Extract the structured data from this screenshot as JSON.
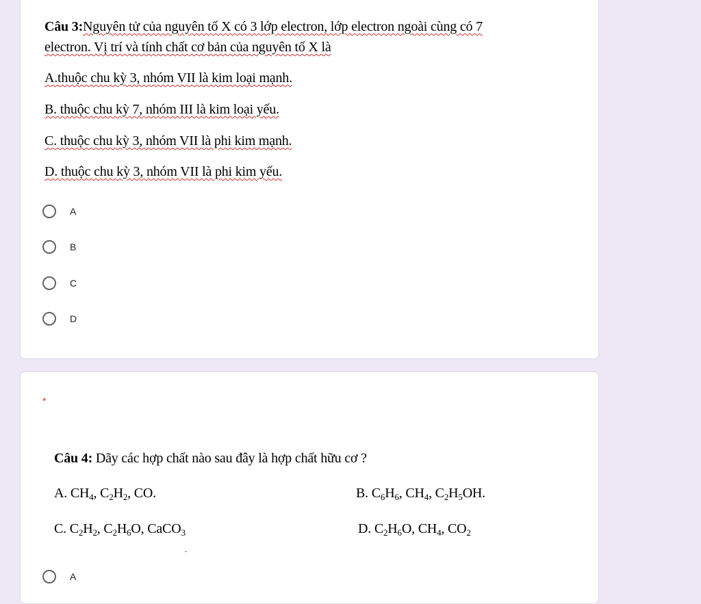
{
  "q3": {
    "line1_bold": "Câu 3:",
    "line1_rest": "Nguyên tử của nguyên tố X có 3 lớp electron, lớp electron ngoài cùng có 7",
    "line2": "electron. Vị trí và tính chất cơ bản của nguyên tố X là",
    "opt_a": "A.thuộc chu kỳ 3, nhóm VII là kim loại mạnh.",
    "opt_b": "B. thuộc chu kỳ 7, nhóm III là kim loại yếu.",
    "opt_c": "C. thuộc chu kỳ 3, nhóm VII là phi kim mạnh.",
    "opt_d": "D. thuộc chu kỳ 3, nhóm VII là phi kim yếu.",
    "choices": [
      "A",
      "B",
      "C",
      "D"
    ]
  },
  "q4": {
    "required_mark": "*",
    "title_bold": "Câu 4:",
    "title_rest": " Dãy các hợp chất nào sau đây là hợp chất hữu cơ ?",
    "opt_a": {
      "p1": "A. CH",
      "s1": "4",
      "p2": ", C",
      "s2": "2",
      "p3": "H",
      "s3": "2",
      "p4": ", CO."
    },
    "opt_b": {
      "p1": "B. C",
      "s1": "6",
      "p2": "H",
      "s2": "6",
      "p3": ", CH",
      "s3": "4",
      "p4": ", C",
      "s4": "2",
      "p5": "H",
      "s5": "5",
      "p6": "OH."
    },
    "opt_c": {
      "p1": "C. C",
      "s1": "2",
      "p2": "H",
      "s2": "2",
      "p3": ", C",
      "s3": "2",
      "p4": "H",
      "s4": "6",
      "p5": "O, CaCO",
      "s5": "3"
    },
    "opt_d": {
      "p1": "D. C",
      "s1": "2",
      "p2": "H",
      "s2": "6",
      "p3": "O, CH",
      "s3": "4",
      "p4": ", CO",
      "s4": "2"
    },
    "choices": [
      "A"
    ]
  }
}
